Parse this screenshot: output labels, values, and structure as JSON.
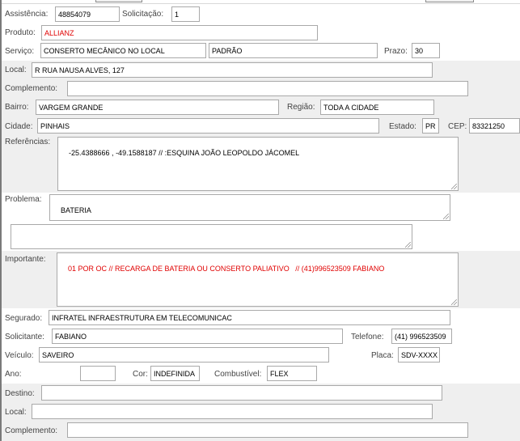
{
  "row1": {
    "assistencia_label": "Assistência:",
    "assistencia_value": "48854079",
    "solicitacao_label": "Solicitação:",
    "solicitacao_value": "1"
  },
  "produto": {
    "label": "Produto:",
    "value": "ALLIANZ"
  },
  "servico": {
    "label": "Serviço:",
    "value": "CONSERTO MECÂNICO NO LOCAL",
    "tipo": "PADRÃO",
    "prazo_label": "Prazo:",
    "prazo_value": "30"
  },
  "local": {
    "label": "Local:",
    "value": "R RUA NAUSA ALVES, 127"
  },
  "complemento": {
    "label": "Complemento:",
    "value": ""
  },
  "bairro": {
    "label": "Bairro:",
    "value": "VARGEM GRANDE",
    "regiao_label": "Região:",
    "regiao_value": "TODA A CIDADE"
  },
  "cidade": {
    "label": "Cidade:",
    "value": "PINHAIS",
    "estado_label": "Estado:",
    "estado_value": "PR",
    "cep_label": "CEP:",
    "cep_value": "83321250"
  },
  "referencias": {
    "label": "Referências:",
    "value": "-25.4388666 , -49.1588187 // :ESQUINA JOÃO LEOPOLDO JÁCOMEL"
  },
  "problema": {
    "label": "Problema:",
    "value": "BATERIA",
    "extra": ""
  },
  "importante": {
    "label": "Importante:",
    "value": "01 POR OC // RECARGA DE BATERIA OU CONSERTO PALIATIVO   // (41)996523509 FABIANO"
  },
  "segurado": {
    "label": "Segurado:",
    "value": "INFRATEL INFRAESTRUTURA EM TELECOMUNICAC"
  },
  "solicitante": {
    "label": "Solicitante:",
    "value": "FABIANO",
    "telefone_label": "Telefone:",
    "telefone_value": "(41) 996523509"
  },
  "veiculo": {
    "label": "Veículo:",
    "value": "SAVEIRO",
    "placa_label": "Placa:",
    "placa_value": "SDV-XXXX"
  },
  "ano_row": {
    "ano_label": "Ano:",
    "ano_value": "",
    "cor_label": "Cor:",
    "cor_value": "INDEFINIDA",
    "combustivel_label": "Combustível:",
    "combustivel_value": "FLEX"
  },
  "destino": {
    "label": "Destino:",
    "value": ""
  },
  "destino_local": {
    "label": "Local:",
    "value": ""
  },
  "destino_complemento": {
    "label": "Complemento:",
    "value": ""
  },
  "colors": {
    "band_gray": "#efefef",
    "red_text": "#e00000"
  }
}
